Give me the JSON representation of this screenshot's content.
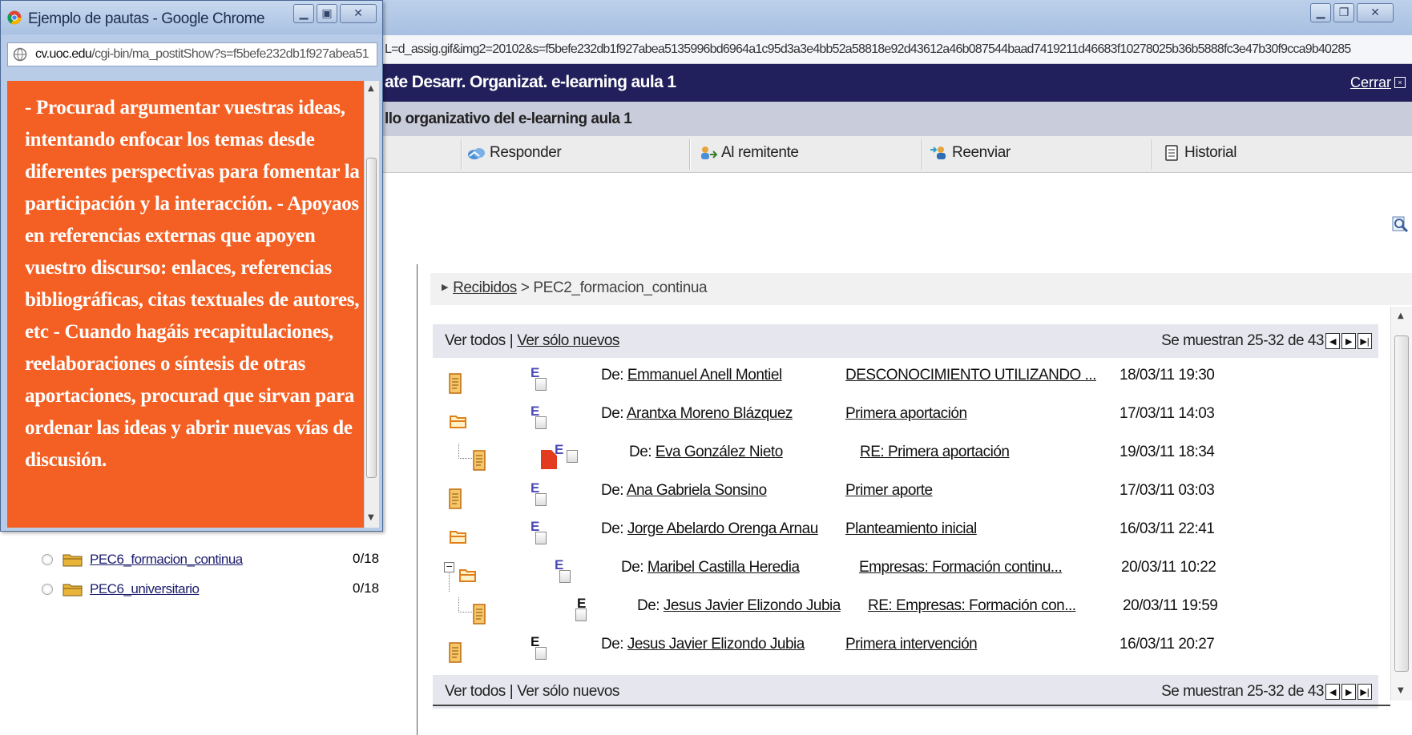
{
  "background_window": {
    "url_text": "L=d_assig.gif&img2=20102&s=f5befe232db1f927abea5135996bd6964a1c95d3a3e4bb52a58818e92d43612a46b087544baad7419211d46683f10278025b36b5888fc3e47b30f9cca9b40285",
    "header_title": "ate Desarr. Organizat. e-learning aula 1",
    "close_label": "Cerrar",
    "subheader_title": "llo organizativo del e-learning aula 1",
    "toolbar": {
      "reply": "Responder",
      "to_sender": "Al remitente",
      "forward": "Reenviar",
      "history": "Historial"
    }
  },
  "popup": {
    "title": "Ejemplo de pautas - Google Chrome",
    "url_domain": "cv.uoc.edu",
    "url_path": "/cgi-bin/ma_postitShow?s=f5befe232db1f927abea51",
    "body_text": "- Procurad argumentar vuestras ideas, intentando enfocar los temas desde diferentes perspectivas para fomentar la participación y la interacción. - Apoyaos en referencias externas que apoyen vuestro discurso: enlaces, referencias bibliográficas, citas textuales de autores, etc - Cuando hagáis recapitulaciones, reelaboraciones o síntesis de otras aportaciones, procurad que sirvan para ordenar las ideas y abrir nuevas vías de discusión."
  },
  "folders": [
    {
      "name": "PEC6_formacion_continua",
      "count": "0/18"
    },
    {
      "name": "PEC6_universitario",
      "count": "0/18"
    }
  ],
  "breadcrumb": {
    "root": "Recibidos",
    "separator": ">",
    "current": "PEC2_formacion_continua"
  },
  "pager": {
    "view_all": "Ver todos",
    "divider": "|",
    "view_new": "Ver sólo nuevos",
    "showing": "Se muestran 25-32 de 43"
  },
  "messages": [
    {
      "flag": "E",
      "from_prefix": "De:",
      "from": "Emmanuel Anell Montiel",
      "subject": "DESCONOCIMIENTO UTILIZANDO ...",
      "date": "18/03/11 19:30"
    },
    {
      "flag": "E",
      "from_prefix": "De:",
      "from": "Arantxa Moreno Blázquez",
      "subject": "Primera aportación",
      "date": "17/03/11 14:03"
    },
    {
      "flag": "E",
      "from_prefix": "De:",
      "from": "Eva González Nieto",
      "subject": "RE: Primera aportación",
      "date": "19/03/11 18:34"
    },
    {
      "flag": "E",
      "from_prefix": "De:",
      "from": "Ana Gabriela Sonsino",
      "subject": "Primer aporte",
      "date": "17/03/11 03:03"
    },
    {
      "flag": "E",
      "from_prefix": "De:",
      "from": "Jorge Abelardo Orenga Arnau",
      "subject": "Planteamiento inicial",
      "date": "16/03/11 22:41"
    },
    {
      "flag": "E",
      "from_prefix": "De:",
      "from": "Maribel Castilla Heredia",
      "subject": "Empresas: Formación continu...",
      "date": "20/03/11 10:22"
    },
    {
      "flag": "E",
      "from_prefix": "De:",
      "from": "Jesus Javier Elizondo Jubia",
      "subject": "RE: Empresas: Formación con...",
      "date": "20/03/11 19:59"
    },
    {
      "flag": "E",
      "from_prefix": "De:",
      "from": "Jesus Javier Elizondo Jubia",
      "subject": "Primera intervención",
      "date": "16/03/11 20:27"
    }
  ],
  "colors": {
    "header_navy": "#22205c",
    "popup_orange": "#f46024",
    "folder_yellow": "#e8b43a",
    "doc_orange": "#e07f17"
  }
}
